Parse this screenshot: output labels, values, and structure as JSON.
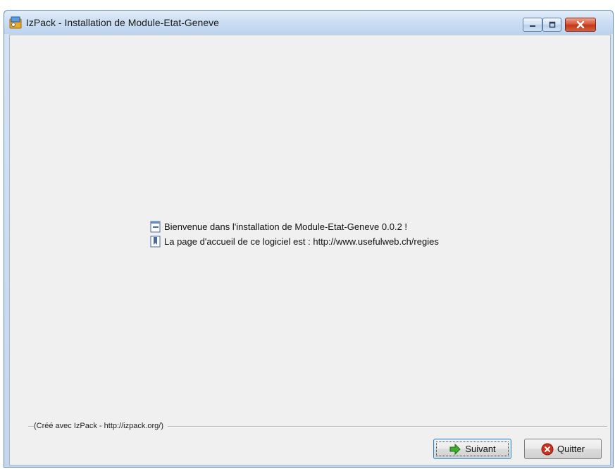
{
  "window": {
    "title": "IzPack - Installation de Module-Etat-Geneve",
    "app_icon": "izpack-installer-icon",
    "controls": [
      "minimize-icon",
      "maximize-icon",
      "close-icon"
    ]
  },
  "content": {
    "welcome_text": "Bienvenue dans l'installation de Module-Etat-Geneve 0.0.2 !",
    "welcome_icon": "info-document-icon",
    "homepage_text": "La page d'accueil de ce logiciel est : http://www.usefulweb.ch/regies",
    "homepage_icon": "bookmark-icon"
  },
  "footer": {
    "credit": "(Créé avec IzPack - http://izpack.org/)",
    "next_label": "Suivant",
    "next_icon": "green-arrow-right-icon",
    "quit_label": "Quitter",
    "quit_icon": "red-x-circle-icon"
  },
  "colors": {
    "title_bar": "#cddff3",
    "client_bg": "#f0f0f0",
    "close_button": "#c1381a",
    "next_arrow": "#3fae2a"
  }
}
